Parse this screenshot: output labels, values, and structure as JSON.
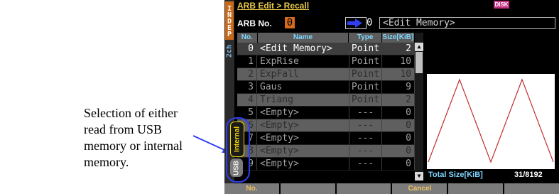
{
  "annotation": {
    "caption": "Selection of either read from USB memory or internal memory."
  },
  "screen": {
    "channel_mode": "INDEP",
    "channel": "2ch",
    "title": "ARB Edit > Recall",
    "disk_badge": "DISK",
    "arb_label": "ARB No.",
    "arb_no": "0",
    "dest_no": "0",
    "dest_name": "<Edit Memory>",
    "columns": [
      "No.",
      "Name",
      "Type",
      "Size[KiB]"
    ],
    "rows": [
      {
        "no": "0",
        "name": "<Edit Memory>",
        "type": "Point",
        "size": "2"
      },
      {
        "no": "1",
        "name": "ExpRise",
        "type": "Point",
        "size": "10"
      },
      {
        "no": "2",
        "name": "ExpFall",
        "type": "Point",
        "size": "10"
      },
      {
        "no": "3",
        "name": "Gaus",
        "type": "Point",
        "size": "9"
      },
      {
        "no": "4",
        "name": "Triang",
        "type": "Point",
        "size": "2"
      },
      {
        "no": "5",
        "name": "<Empty>",
        "type": "---",
        "size": "0"
      },
      {
        "no": "6",
        "name": "<Empty>",
        "type": "---",
        "size": "0"
      },
      {
        "no": "7",
        "name": "<Empty>",
        "type": "---",
        "size": "0"
      },
      {
        "no": "8",
        "name": "<Empty>",
        "type": "---",
        "size": "0"
      },
      {
        "no": "9",
        "name": "<Empty>",
        "type": "---",
        "size": "0"
      }
    ],
    "total_label": "Total Size[KiB]",
    "total_value": "31/8192",
    "media_tabs": {
      "internal": "Internal",
      "usb": "USB"
    },
    "softkeys": [
      "No.",
      "",
      "",
      "Cancel",
      "",
      ""
    ],
    "colors": {
      "accent": "#e8c94a",
      "selection": "#3e3e3e",
      "highlight": "#2f3ff0",
      "waveform": "#c03030"
    }
  }
}
